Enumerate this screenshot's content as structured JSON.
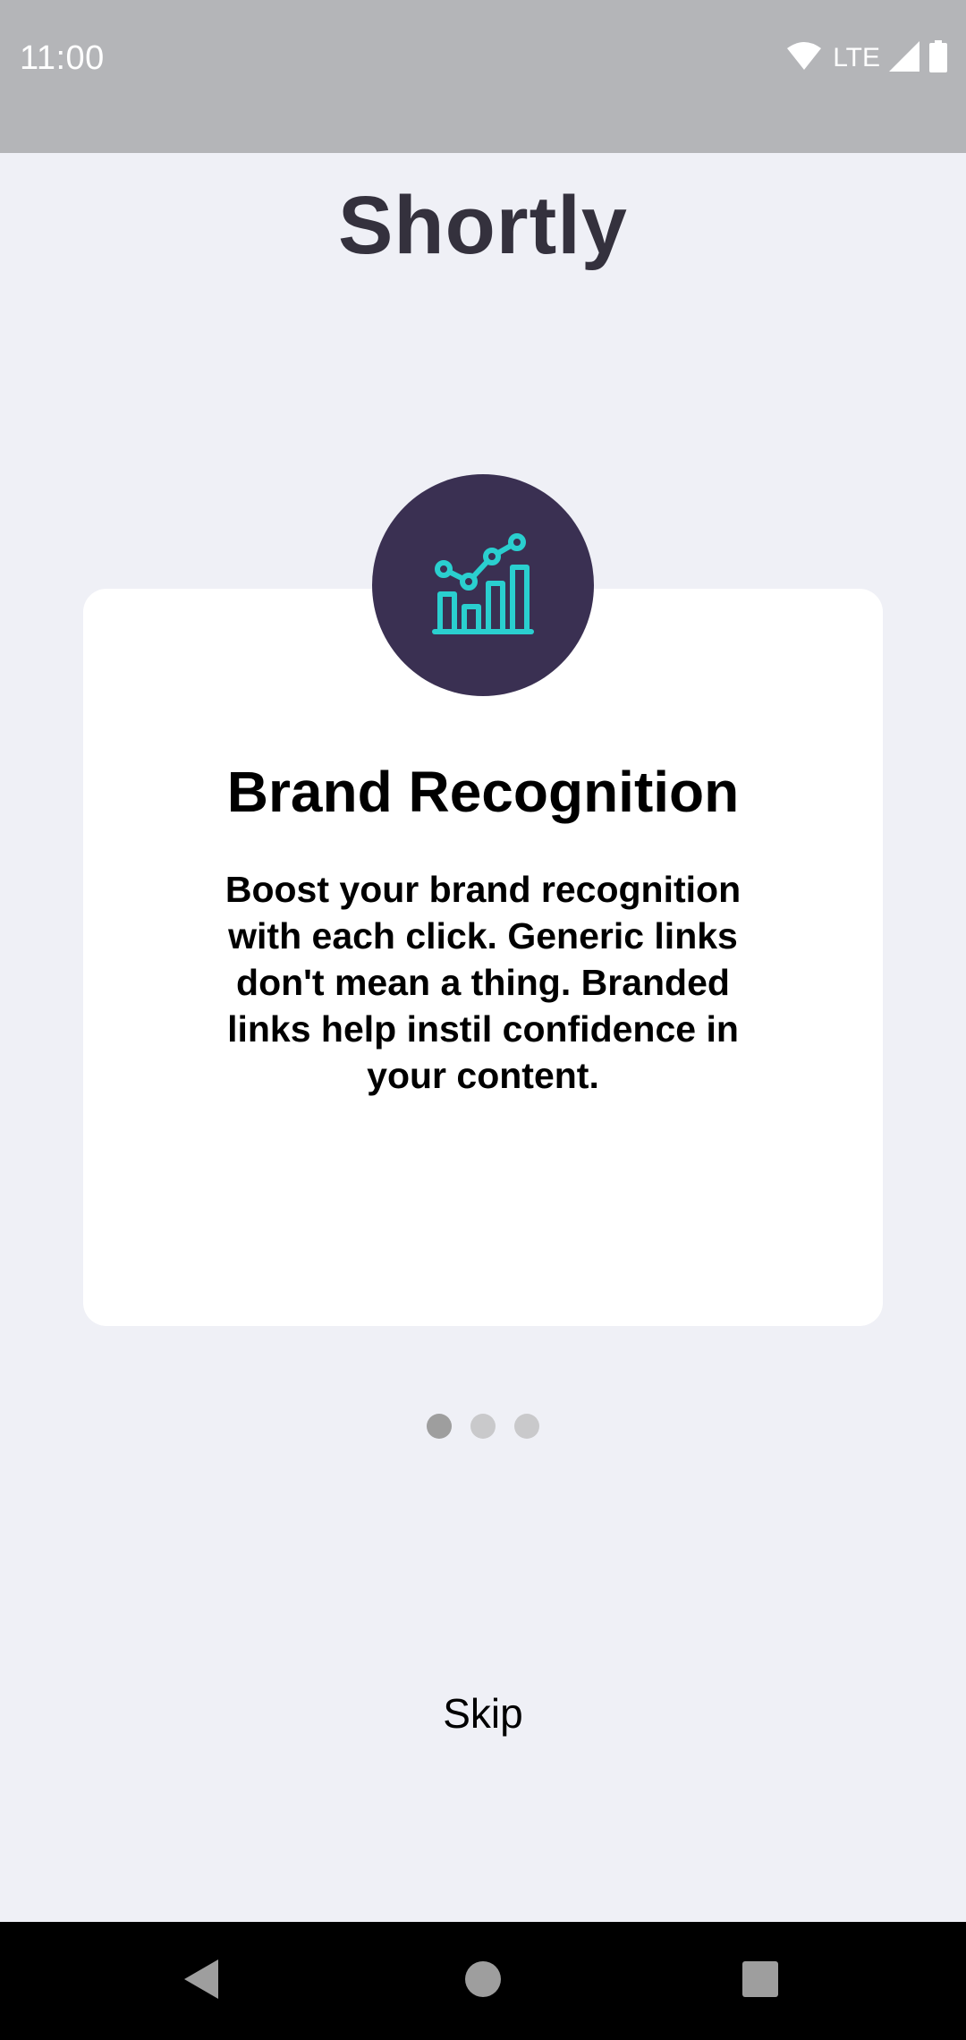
{
  "status_bar": {
    "time": "11:00",
    "network": "LTE",
    "icons": [
      "wifi-icon",
      "signal-icon",
      "battery-icon"
    ],
    "background": "#b4b5b8"
  },
  "app": {
    "title": "Shortly",
    "title_color": "#34313d",
    "background": "#eff0f6"
  },
  "onboarding": {
    "icon": "chart-icon",
    "icon_color": "#2acfcf",
    "badge_color": "#3a3052",
    "title": "Brand Recognition",
    "body": "Boost your brand recognition with each click. Generic links don't mean a thing. Branded links help instil confidence in your content.",
    "page_count": 3,
    "current_page": 1
  },
  "actions": {
    "skip_label": "Skip"
  },
  "nav_bar": {
    "buttons": [
      "back-icon",
      "home-icon",
      "recents-icon"
    ]
  }
}
